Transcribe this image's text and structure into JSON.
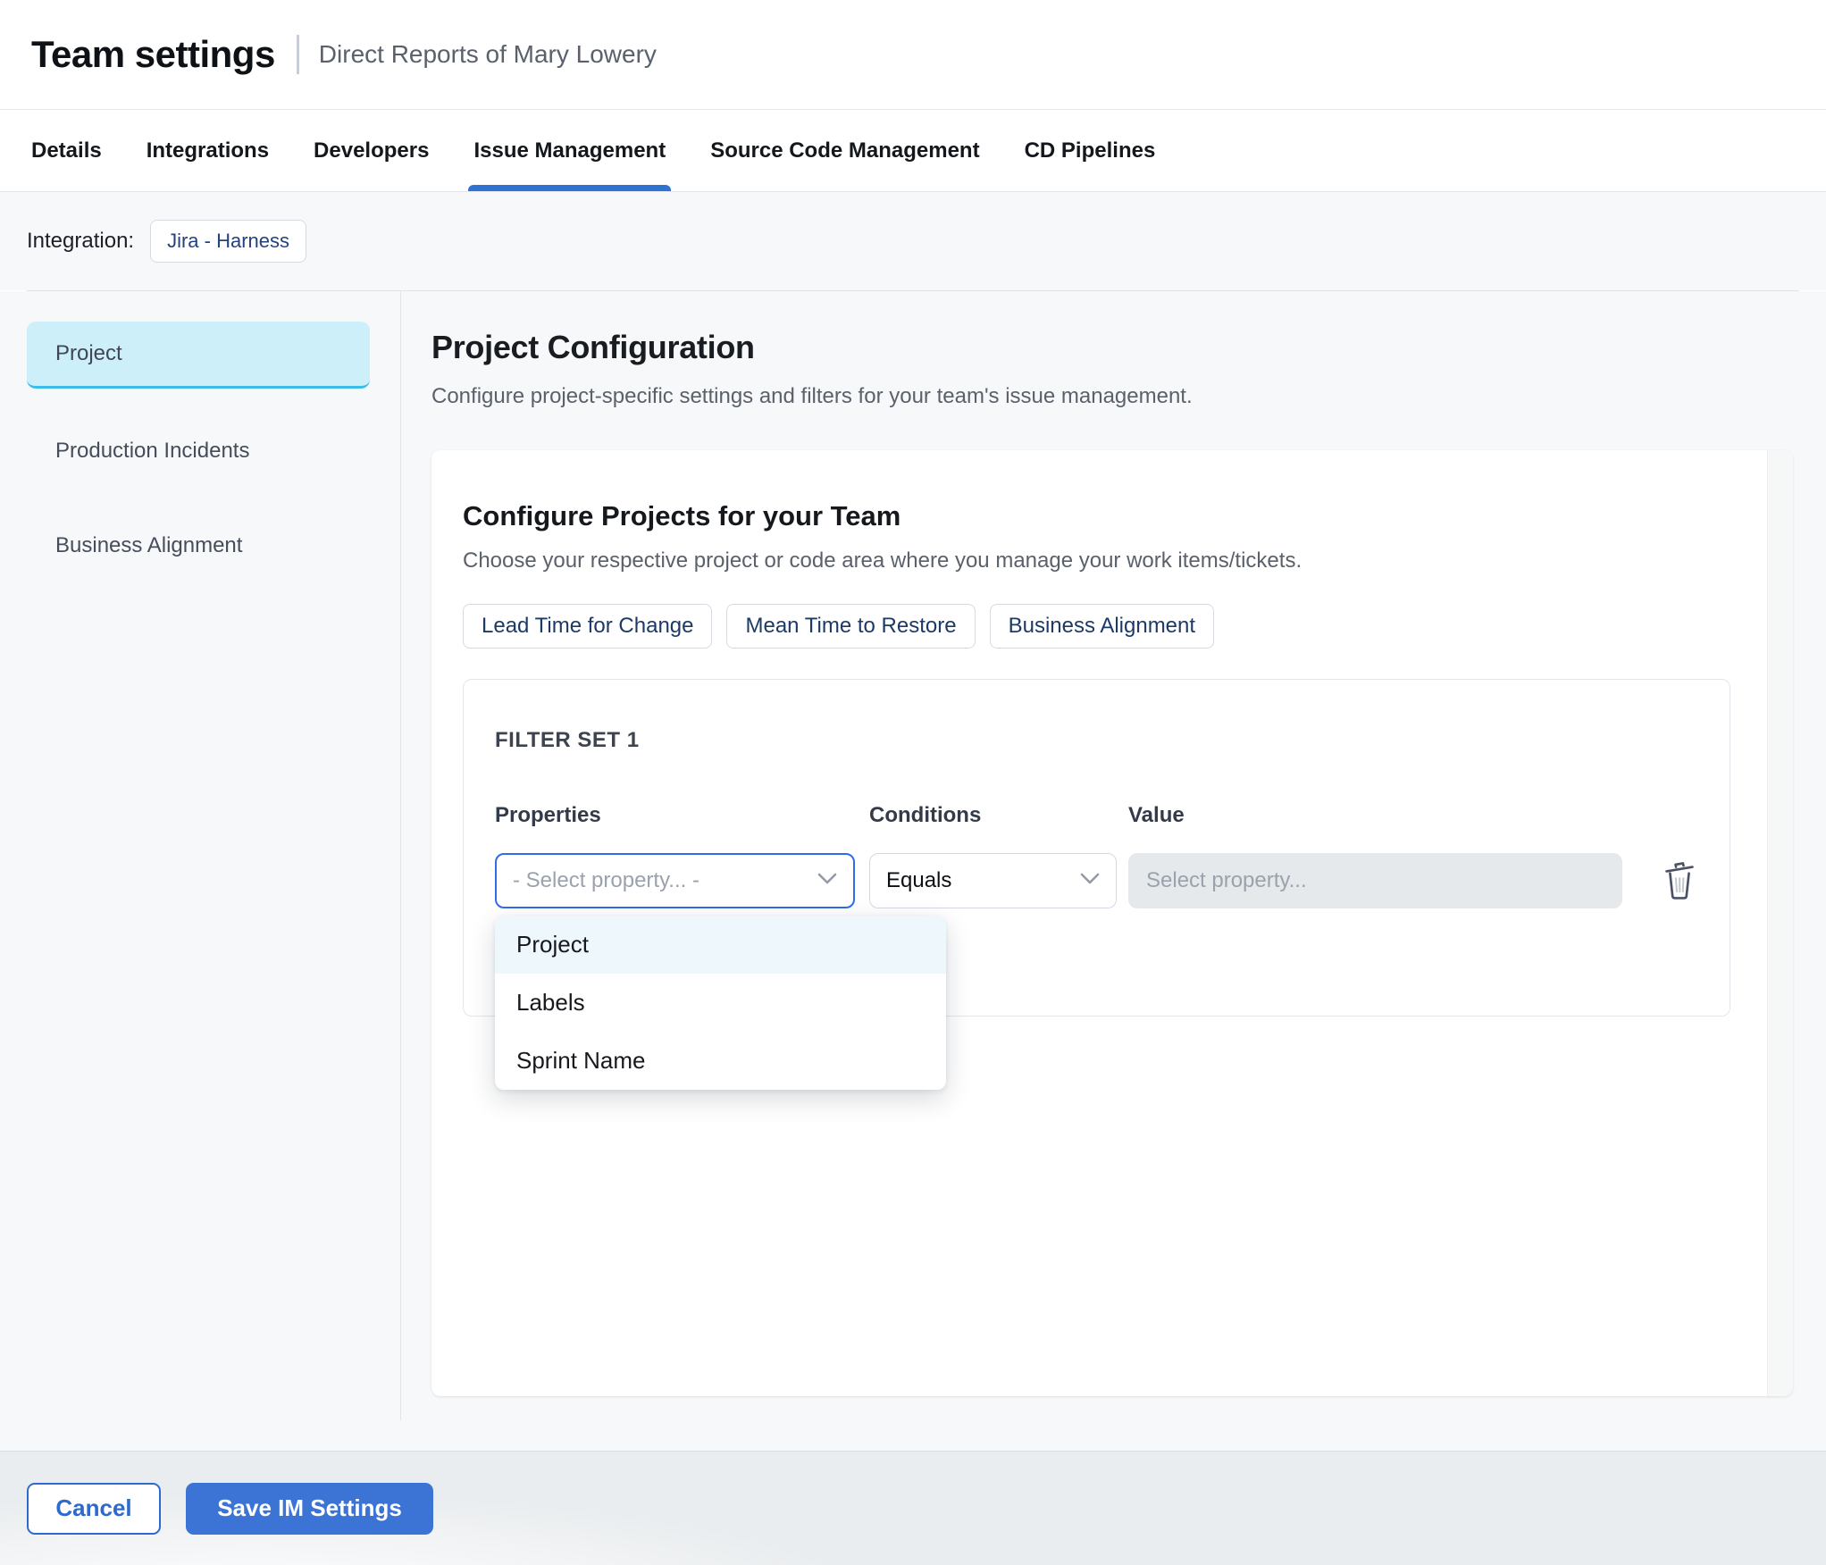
{
  "header": {
    "title": "Team settings",
    "subtitle": "Direct Reports of Mary Lowery"
  },
  "tabs": [
    {
      "label": "Details",
      "active": false
    },
    {
      "label": "Integrations",
      "active": false
    },
    {
      "label": "Developers",
      "active": false
    },
    {
      "label": "Issue Management",
      "active": true
    },
    {
      "label": "Source Code Management",
      "active": false
    },
    {
      "label": "CD Pipelines",
      "active": false
    }
  ],
  "integration": {
    "label": "Integration:",
    "chip": "Jira - Harness"
  },
  "sidebar": {
    "items": [
      {
        "label": "Project",
        "selected": true
      },
      {
        "label": "Production Incidents",
        "selected": false
      },
      {
        "label": "Business Alignment",
        "selected": false
      }
    ]
  },
  "main": {
    "title": "Project Configuration",
    "subtitle": "Configure project-specific settings and filters for your team's issue management.",
    "card": {
      "title": "Configure Projects for your Team",
      "subtitle": "Choose your respective project or code area where you manage your work items/tickets.",
      "metric_chips": [
        "Lead Time for Change",
        "Mean Time to Restore",
        "Business Alignment"
      ],
      "filter_set": {
        "title": "FILTER SET 1",
        "columns": [
          "Properties",
          "Conditions",
          "Value"
        ],
        "property_placeholder": "- Select property... -",
        "condition_value": "Equals",
        "value_placeholder": "Select property...",
        "dropdown_options": [
          {
            "label": "Project",
            "highlighted": true
          },
          {
            "label": "Labels",
            "highlighted": false
          },
          {
            "label": "Sprint Name",
            "highlighted": false
          }
        ]
      }
    }
  },
  "footer": {
    "cancel_label": "Cancel",
    "save_label": "Save IM Settings"
  },
  "icons": {
    "trash": "trash-icon",
    "chevron": "chevron-down-icon"
  },
  "colors": {
    "accent_blue": "#2e72d2",
    "focus_border": "#2f6ce6",
    "save_button": "#3b74d4",
    "cancel_button": "#2e6ace",
    "selected_sidebar_bg": "#cdeff9",
    "selected_sidebar_border": "#3cbde9",
    "dropdown_highlight": "#edf7fc",
    "content_bg": "#f7f8fa",
    "disabled_input_bg": "#e5e9eb",
    "chip_text": "#1d3a66"
  }
}
